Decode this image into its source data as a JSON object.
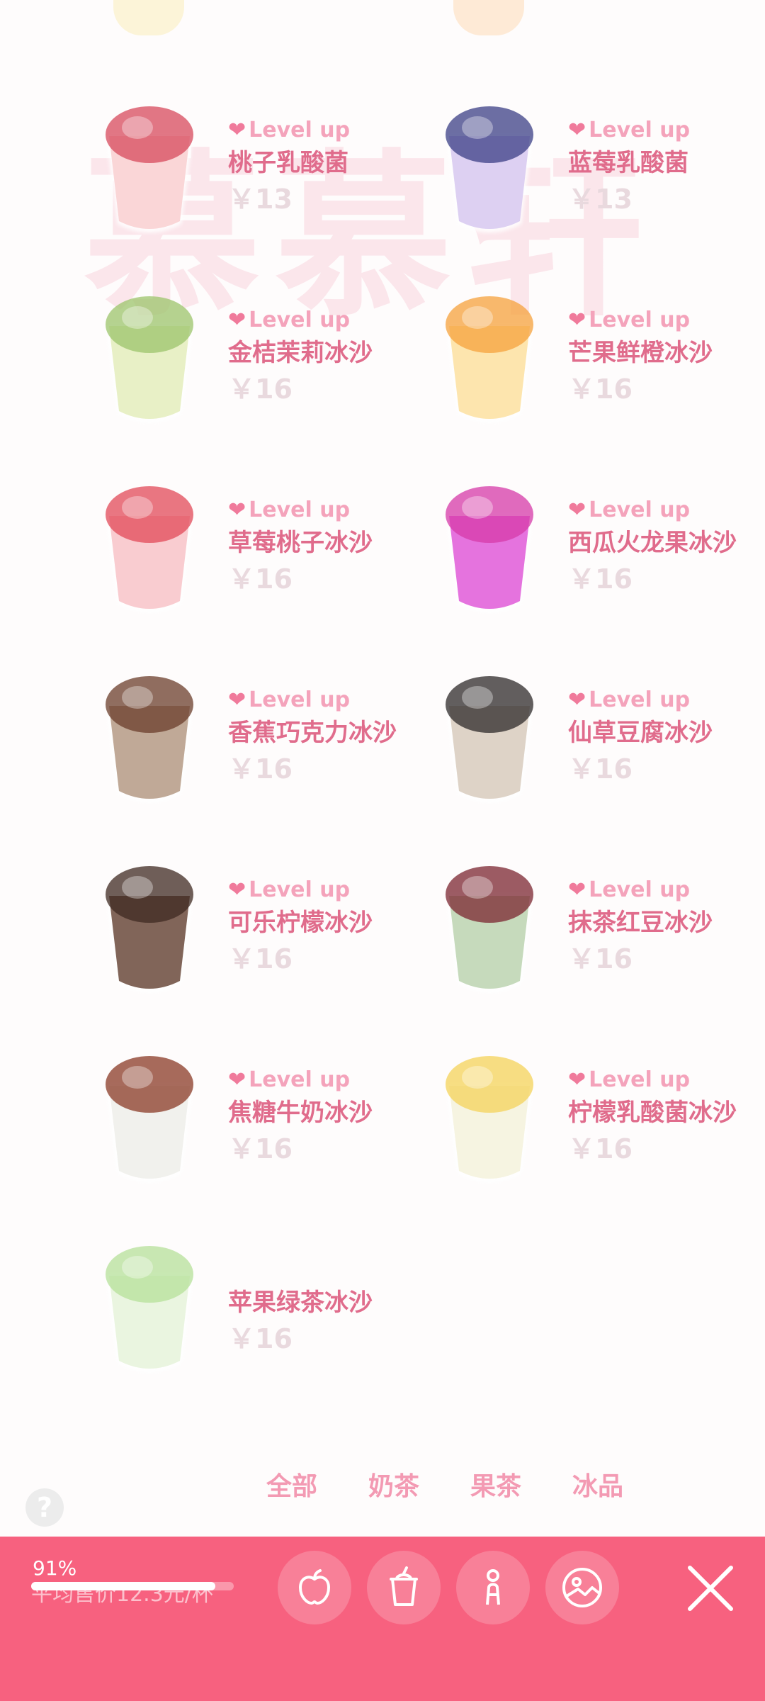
{
  "watermark": "慕慕轩",
  "menu": {
    "level_up": "Level up",
    "items": [
      {
        "name": "桃子乳酸菌",
        "price": "￥13",
        "cup_color": "#f9cfd0",
        "top_color": "#d74a5c",
        "level": true
      },
      {
        "name": "蓝莓乳酸菌",
        "price": "￥13",
        "cup_color": "#d7c8f0",
        "top_color": "#3b3f86",
        "level": true
      },
      {
        "name": "金桔茉莉冰沙",
        "price": "￥16",
        "cup_color": "#e4edbc",
        "top_color": "#9cc46b",
        "level": true
      },
      {
        "name": "芒果鲜橙冰沙",
        "price": "￥16",
        "cup_color": "#fde1a0",
        "top_color": "#f6a13c",
        "level": true
      },
      {
        "name": "草莓桃子冰沙",
        "price": "￥16",
        "cup_color": "#f8c3c8",
        "top_color": "#e24a58",
        "level": true
      },
      {
        "name": "西瓜火龙果冰沙",
        "price": "￥16",
        "cup_color": "#e05bd8",
        "top_color": "#d63aa8",
        "level": true
      },
      {
        "name": "香蕉巧克力冰沙",
        "price": "￥16",
        "cup_color": "#b59a85",
        "top_color": "#6b3d2b",
        "level": true
      },
      {
        "name": "仙草豆腐冰沙",
        "price": "￥16",
        "cup_color": "#d8cbbd",
        "top_color": "#2e2a2a",
        "level": true
      },
      {
        "name": "可乐柠檬冰沙",
        "price": "￥16",
        "cup_color": "#6b4a3c",
        "top_color": "#3f2a22",
        "level": true
      },
      {
        "name": "抹茶红豆冰沙",
        "price": "￥16",
        "cup_color": "#bcd4b0",
        "top_color": "#7b2630",
        "level": true
      },
      {
        "name": "焦糖牛奶冰沙",
        "price": "￥16",
        "cup_color": "#eeeeea",
        "top_color": "#8a3a26",
        "level": true
      },
      {
        "name": "柠檬乳酸菌冰沙",
        "price": "￥16",
        "cup_color": "#f4f2dc",
        "top_color": "#f4d35a",
        "level": true
      },
      {
        "name": "苹果绿茶冰沙",
        "price": "￥16",
        "cup_color": "#e6f3da",
        "top_color": "#b6e09a",
        "level": false
      }
    ]
  },
  "tabs": [
    "全部",
    "奶茶",
    "果茶",
    "冰品"
  ],
  "help_label": "?",
  "bottom_bar": {
    "progress_label": "91%",
    "progress_fraction": 0.91,
    "avg_price_label": "平均售价12.3元/杯"
  },
  "colors": {
    "accent": "#f7617f",
    "label_pink": "#e06c8c",
    "tab_pink": "#f39ab3"
  }
}
